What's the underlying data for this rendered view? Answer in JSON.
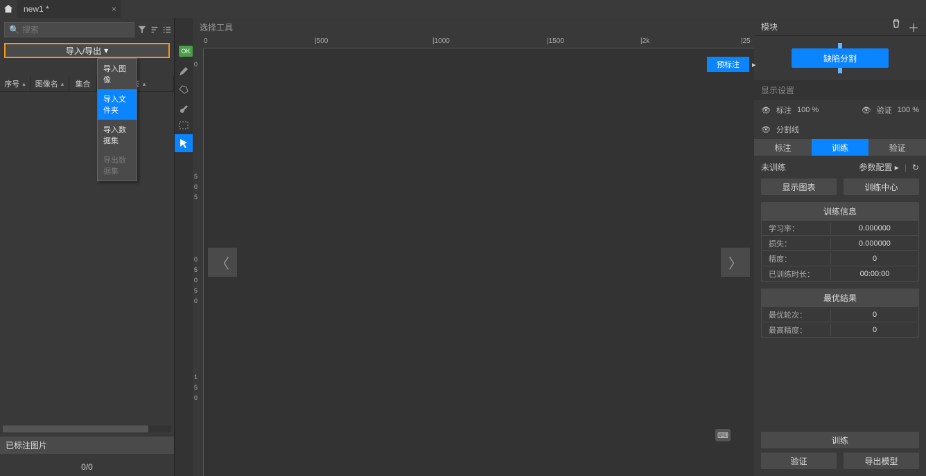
{
  "tabbar": {
    "tab_title": "new1 *"
  },
  "left": {
    "search_placeholder": "搜索",
    "import_export_label": "导入/导出",
    "dropdown": {
      "import_image": "导入图像",
      "import_folder": "导入文件夹",
      "import_dataset": "导入数据集",
      "export_dataset": "导出数据集"
    },
    "columns": {
      "index": "序号",
      "name": "图像名",
      "set": "集合",
      "label": "标签"
    },
    "annotated_title": "已标注图片",
    "count": "0/0"
  },
  "canvas": {
    "tool_title": "选择工具",
    "predict_label": "预标注",
    "ok": "OK",
    "ruler_h": [
      "0",
      "|500",
      "|1000",
      "|1500",
      "|2k",
      "|25"
    ],
    "ruler_v": [
      "0",
      "5",
      "0",
      "5",
      "0",
      "5",
      "0",
      "5",
      "0",
      "1",
      "5",
      "0"
    ]
  },
  "right": {
    "module_label": "模块",
    "big_button": "缺陷分割",
    "display_settings": "显示设置",
    "row1": {
      "label1": "标注",
      "val1": "100 %",
      "label2": "验证",
      "val2": "100 %"
    },
    "row2_label": "分割线",
    "tabs": {
      "t1": "标注",
      "t2": "训练",
      "t3": "验证"
    },
    "not_trained": "未训练",
    "param_config": "参数配置",
    "show_chart": "显示图表",
    "train_center": "训练中心",
    "train_info": {
      "header": "训练信息",
      "lr_label": "学习率：",
      "lr_val": "0.000000",
      "loss_label": "损失：",
      "loss_val": "0.000000",
      "acc_label": "精度：",
      "acc_val": "0",
      "time_label": "已训练时长：",
      "time_val": "00:00:00"
    },
    "best": {
      "header": "最优结果",
      "epoch_label": "最优轮次：",
      "epoch_val": "0",
      "acc_label": "最高精度：",
      "acc_val": "0"
    },
    "footer": {
      "train": "训练",
      "verify": "验证",
      "export_model": "导出模型"
    }
  }
}
